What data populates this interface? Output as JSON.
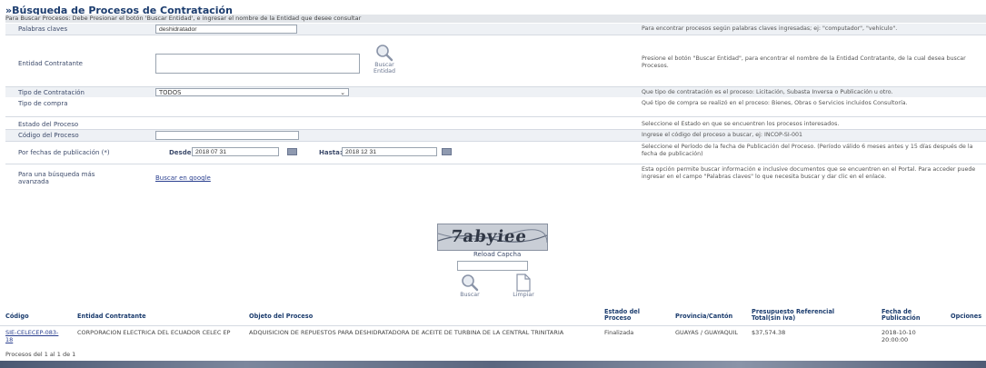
{
  "page": {
    "title": "»Búsqueda de Procesos de Contratación",
    "subtitle": "Para Buscar Procesos: Debe Presionar el botón 'Buscar Entidad', e ingresar el nombre de la Entidad que desee consultar"
  },
  "form": {
    "keywords": {
      "label": "Palabras claves",
      "value": "deshidratador",
      "help": "Para encontrar procesos según palabras claves ingresadas; ej: \"computador\", \"vehículo\"."
    },
    "entity": {
      "label": "Entidad Contratante",
      "value": "",
      "button_label": "Buscar Entidad",
      "help": "Presione el botón \"Buscar Entidad\", para encontrar el nombre de la Entidad Contratante, de la cual desea buscar Procesos."
    },
    "contract_type": {
      "label": "Tipo de Contratación",
      "value": "TODOS",
      "help": "Que tipo de contratación es el proceso: Licitación, Subasta Inversa o Publicación u otro."
    },
    "purchase_type": {
      "label": "Tipo de compra",
      "help": "Qué tipo de compra se realizó en el proceso: Bienes, Obras o Servicios incluidos Consultoría."
    },
    "status": {
      "label": "Estado del Proceso",
      "help": "Seleccione el Estado en que se encuentren los procesos interesados."
    },
    "code": {
      "label": "Código del Proceso",
      "value": "",
      "help": "Ingrese el código del proceso a buscar, ej: INCOP-SI-001"
    },
    "dates": {
      "label": "Por fechas de publicación (*)",
      "from_label": "Desde:",
      "from_value": "2018 07 31",
      "to_label": "Hasta:",
      "to_value": "2018 12 31",
      "help": "Seleccione el Período de la fecha de Publicación del Proceso. (Período válido 6 meses antes y 15 días después de la fecha de publicación)"
    },
    "advanced": {
      "label": "Para una búsqueda más avanzada",
      "link": "Buscar en google",
      "help": "Esta opción permite buscar información e inclusive documentos que se encuentren en el Portal. Para acceder puede ingresar en el campo \"Palabras claves\" lo que necesita buscar y dar clic en el enlace."
    }
  },
  "captcha": {
    "text": "7abyiee",
    "reload_label": "Reload Capcha",
    "input_value": ""
  },
  "actions": {
    "search_label": "Buscar",
    "clear_label": "Limpiar"
  },
  "results": {
    "headers": [
      "Código",
      "Entidad Contratante",
      "Objeto del Proceso",
      "Estado del Proceso",
      "Provincia/Cantón",
      "Presupuesto Referencial Total(sin iva)",
      "Fecha de Publicación",
      "Opciones"
    ],
    "rows": [
      {
        "code": "SIE-CELECEP-083-18",
        "entity": "CORPORACION ELECTRICA DEL ECUADOR CELEC EP",
        "object": "ADQUISICION DE REPUESTOS PARA DESHIDRATADORA DE ACEITE DE TURBINA DE LA CENTRAL TRINITARIA",
        "status": "Finalizada",
        "location": "GUAYAS / GUAYAQUIL",
        "budget": "$37,574.38",
        "date": "2018-10-10 20:00:00"
      }
    ],
    "count_text": "Procesos del 1 al 1 de 1"
  }
}
